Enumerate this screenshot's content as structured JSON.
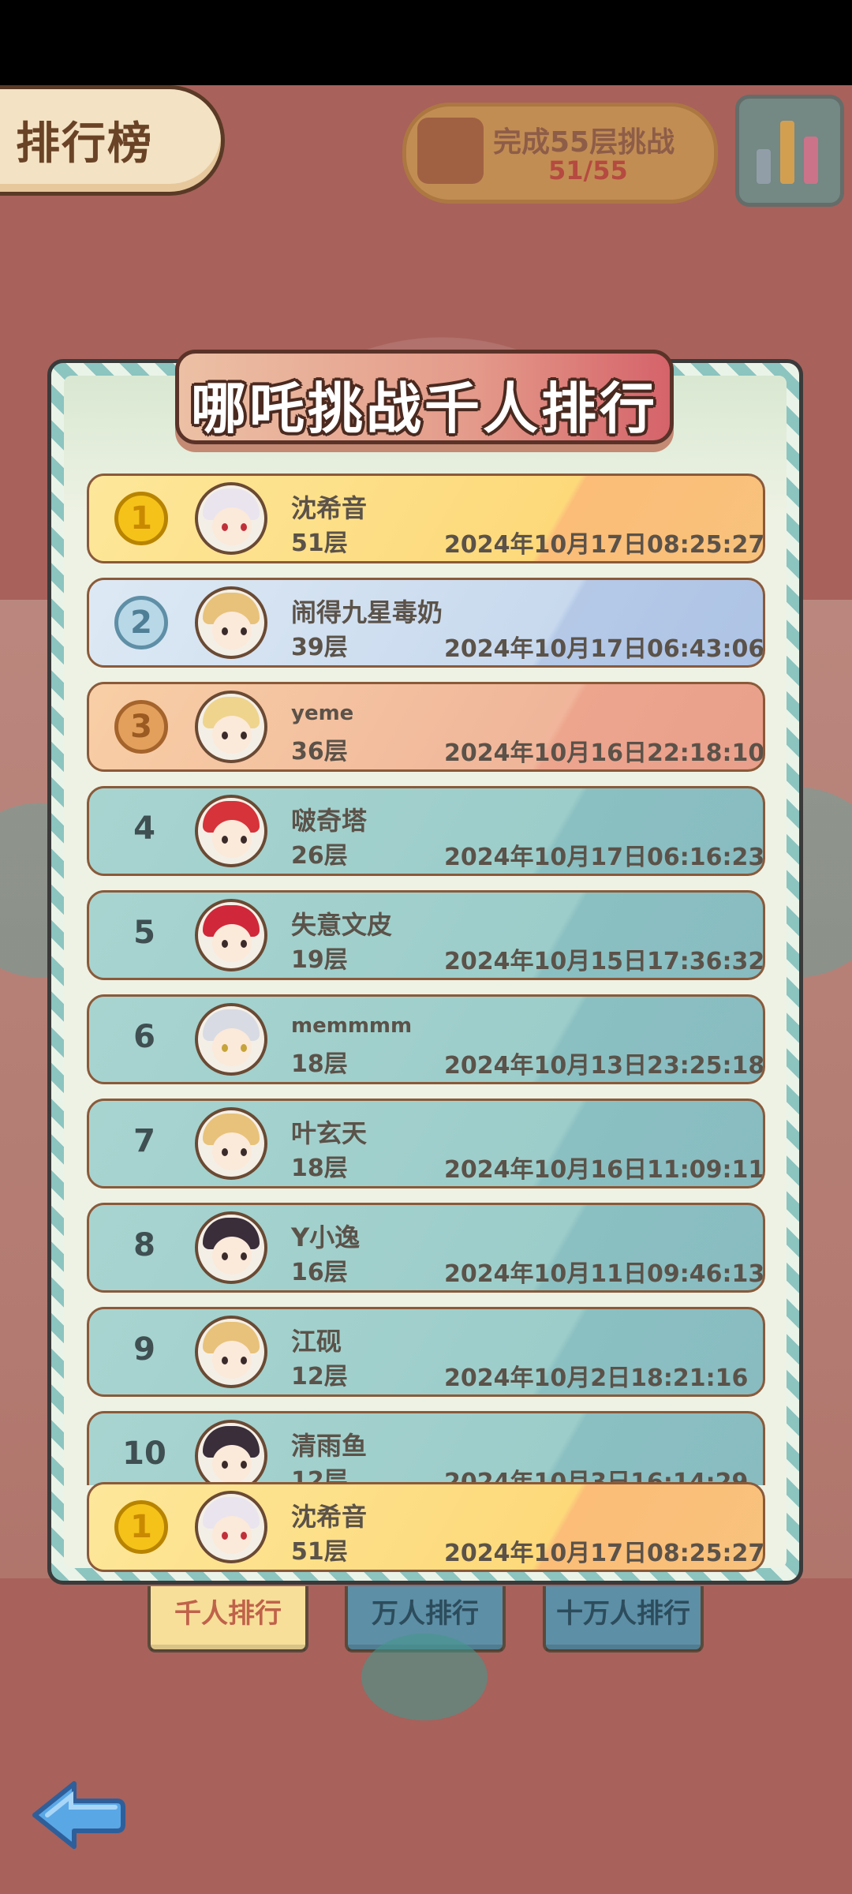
{
  "header": {
    "title": "排行榜",
    "task_line1": "完成55层挑战",
    "task_line2": "51/55"
  },
  "panel": {
    "banner_title": "哪吒挑战千人排行"
  },
  "ranking": [
    {
      "rank": "1",
      "medal": "gold",
      "name": "沈希音",
      "floor": "51层",
      "time": "2024年10月17日08:25:27"
    },
    {
      "rank": "2",
      "medal": "silver",
      "name": "闹得九星毒奶",
      "floor": "39层",
      "time": "2024年10月17日06:43:06"
    },
    {
      "rank": "3",
      "medal": "bronze",
      "name": "yeme",
      "floor": "36层",
      "time": "2024年10月16日22:18:10"
    },
    {
      "rank": "4",
      "name": "啵奇塔",
      "floor": "26层",
      "time": "2024年10月17日06:16:23"
    },
    {
      "rank": "5",
      "name": "失意文皮",
      "floor": "19层",
      "time": "2024年10月15日17:36:32"
    },
    {
      "rank": "6",
      "name": "memmmm",
      "floor": "18层",
      "time": "2024年10月13日23:25:18"
    },
    {
      "rank": "7",
      "name": "叶玄天",
      "floor": "18层",
      "time": "2024年10月16日11:09:11"
    },
    {
      "rank": "8",
      "name": "Y小逸",
      "floor": "16层",
      "time": "2024年10月11日09:46:13"
    },
    {
      "rank": "9",
      "name": "江砚",
      "floor": "12层",
      "time": "2024年10月2日18:21:16"
    },
    {
      "rank": "10",
      "name": "清雨鱼",
      "floor": "12层",
      "time": "2024年10月3日16:14:29"
    }
  ],
  "my_rank": {
    "rank": "1",
    "name": "沈希音",
    "floor": "51层",
    "time": "2024年10月17日08:25:27"
  },
  "tabs": [
    "千人排行",
    "万人排行",
    "十万人排行"
  ],
  "colors": {
    "background": "#a8615b",
    "gold_row": "#fde79a",
    "teal_row": "#9ccdca",
    "active_tab": "#f7df9a",
    "inactive_tab": "#5d8fa6"
  }
}
